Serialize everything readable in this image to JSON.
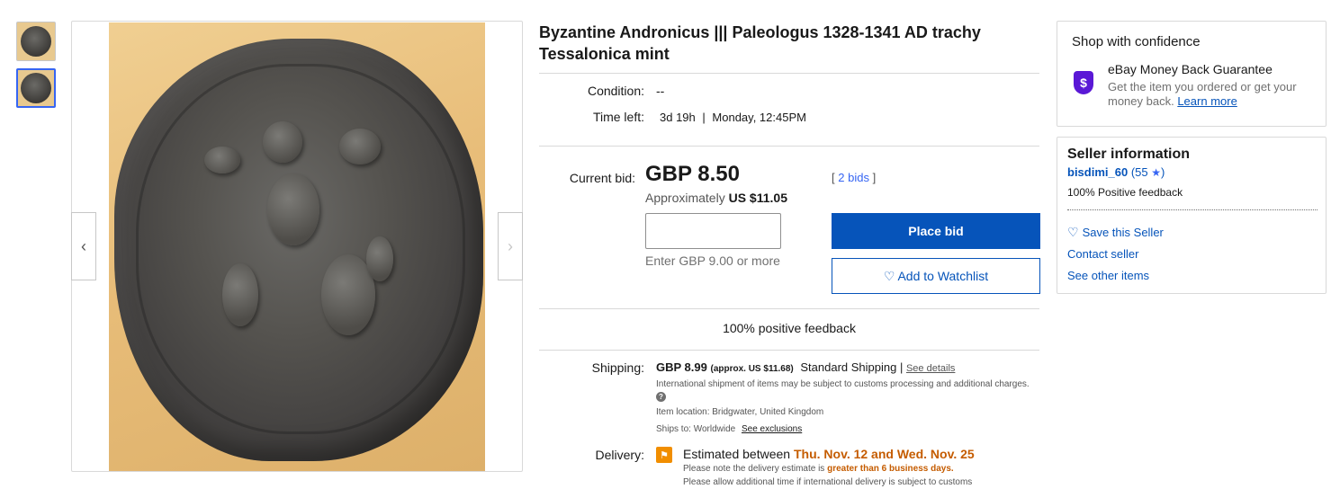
{
  "gallery": {
    "thumbnails": [
      "coin-obverse-thumbnail",
      "coin-reverse-thumbnail"
    ],
    "selected_index": 1,
    "prev_icon": "‹",
    "next_icon": "›"
  },
  "listing": {
    "title": "Byzantine Andronicus ||| Paleologus 1328-1341 AD trachy Tessalonica mint",
    "condition_label": "Condition:",
    "condition_value": "--",
    "time_left_label": "Time left:",
    "time_left_value": "3d 19h",
    "time_left_sep": "|",
    "time_left_end": "Monday, 12:45PM"
  },
  "bid": {
    "current_bid_label": "Current bid:",
    "price": "GBP 8.50",
    "approx_prefix": "Approximately",
    "approx_value": "US $11.05",
    "bids_open": "[",
    "bids_link": "2 bids",
    "bids_close": "]",
    "input_placeholder": "",
    "hint": "Enter GBP 9.00 or more",
    "place_bid": "Place bid",
    "watchlist_icon": "♡",
    "watchlist": "Add to Watchlist"
  },
  "feedback_banner": "100% positive feedback",
  "shipping": {
    "label": "Shipping:",
    "price": "GBP 8.99",
    "approx": "(approx. US $11.68)",
    "method": "Standard Shipping |",
    "see_details": "See details",
    "intl_note": "International shipment of items may be subject to customs processing and additional charges.",
    "help_icon": "?",
    "location_label": "Item location:",
    "location_value": "Bridgwater, United Kingdom",
    "ships_to_label": "Ships to:",
    "ships_to_value": "Worldwide",
    "see_exclusions": "See exclusions"
  },
  "delivery": {
    "label": "Delivery:",
    "flag_icon": "⚑",
    "prefix": "Estimated between",
    "dates": "Thu. Nov. 12 and Wed. Nov. 25",
    "note1_prefix": "Please note the delivery estimate is",
    "note1_bold": "greater than 6 business days.",
    "note2": "Please allow additional time if international delivery is subject to customs"
  },
  "confidence": {
    "title": "Shop with confidence",
    "shield_icon": "$",
    "mbg_title": "eBay Money Back Guarantee",
    "mbg_desc": "Get the item you ordered or get your money back.",
    "learn_more": "Learn more"
  },
  "seller": {
    "title": "Seller information",
    "name": "bisdimi_60",
    "score_open": "(",
    "score": "55",
    "star_icon": "★",
    "score_close": ")",
    "feedback": "100% Positive feedback",
    "save_icon": "♡",
    "save": "Save this Seller",
    "contact": "Contact seller",
    "other_items": "See other items"
  },
  "colors": {
    "primary_button": "#0654ba",
    "link": "#0654ba",
    "delivery_highlight": "#c55c00",
    "shield": "#5a18d6",
    "flag": "#f18e00"
  }
}
